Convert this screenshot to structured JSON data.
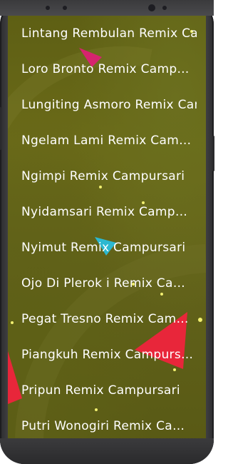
{
  "song_list": {
    "items": [
      {
        "label": "Lintang Rembulan Remix Campursari"
      },
      {
        "label": "Loro Bronto Remix Campursari"
      },
      {
        "label": "Lungiting Asmoro Remix Campursari"
      },
      {
        "label": "Ngelam Lami Remix Campursari"
      },
      {
        "label": "Ngimpi Remix Campursari"
      },
      {
        "label": "Nyidamsari Remix Campursari"
      },
      {
        "label": "Nyimut Remix Campursari"
      },
      {
        "label": "Ojo Di Plerok i Remix Campursari"
      },
      {
        "label": "Pegat Tresno Remix Campursari"
      },
      {
        "label": "Piangkuh Remix Campursari"
      },
      {
        "label": "Pripun Remix Campursari"
      },
      {
        "label": "Putri Wonogiri Remix Campursari"
      }
    ]
  },
  "colors": {
    "background": "#62621a",
    "text": "#ffffff",
    "accent_red": "#e8263a",
    "accent_magenta": "#d6246e",
    "accent_cyan": "#2cb8d0",
    "sparkle": "#f2f070"
  }
}
